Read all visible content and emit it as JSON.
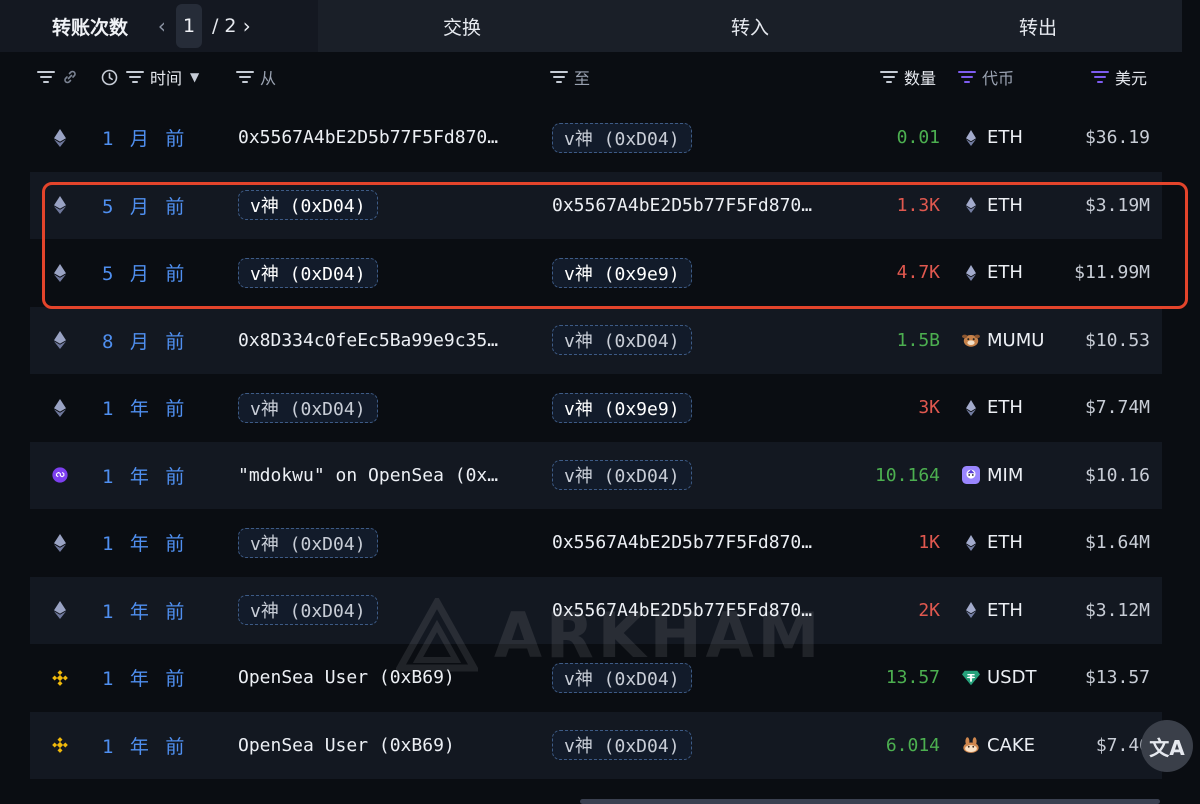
{
  "tabs": {
    "active": "转账次数",
    "pager": {
      "current": "1",
      "sep": "/",
      "total": "2"
    },
    "swap": "交换",
    "in": "转入",
    "out": "转出"
  },
  "columns": {
    "time": "时间",
    "from": "从",
    "to": "至",
    "qty": "数量",
    "token": "代币",
    "usd": "美元"
  },
  "colors": {
    "accent": "#4f8ff0",
    "in": "#4caf50",
    "out": "#e0584f",
    "highlight": "#e3442b",
    "token_filter": "#7e5cf0"
  },
  "rows": [
    {
      "chain": "ethereum-icon",
      "time": "1 月 前",
      "from": "0x5567A4bE2D5b77F5Fd870…",
      "from_pill": false,
      "to": "v神 (0xD04)",
      "to_pill": true,
      "qty": "0.01",
      "dir": "in",
      "token_icon": "eth-icon",
      "token": "ETH",
      "usd": "$36.19"
    },
    {
      "chain": "ethereum-icon",
      "time": "5 月 前",
      "from": "v神 (0xD04)",
      "from_pill": true,
      "to": "0x5567A4bE2D5b77F5Fd870…",
      "to_pill": false,
      "qty": "1.3K",
      "dir": "out",
      "token_icon": "eth-icon",
      "token": "ETH",
      "usd": "$3.19M"
    },
    {
      "chain": "ethereum-icon",
      "time": "5 月 前",
      "from": "v神 (0xD04)",
      "from_pill": true,
      "to": "v神 (0x9e9)",
      "to_pill": true,
      "qty": "4.7K",
      "dir": "out",
      "token_icon": "eth-icon",
      "token": "ETH",
      "usd": "$11.99M"
    },
    {
      "chain": "ethereum-icon",
      "time": "8 月 前",
      "from": "0x8D334c0feEc5Ba99e9c35…",
      "from_pill": false,
      "to": "v神 (0xD04)",
      "to_pill": true,
      "qty": "1.5B",
      "dir": "in",
      "token_icon": "mumu-icon",
      "token": "MUMU",
      "usd": "$10.53"
    },
    {
      "chain": "ethereum-icon",
      "time": "1 年 前",
      "from": "v神 (0xD04)",
      "from_pill": true,
      "to": "v神 (0x9e9)",
      "to_pill": true,
      "qty": "3K",
      "dir": "out",
      "token_icon": "eth-icon",
      "token": "ETH",
      "usd": "$7.74M"
    },
    {
      "chain": "polygon-icon",
      "time": "1 年 前",
      "from": "\"mdokwu\" on OpenSea (0x…",
      "from_pill": false,
      "to": "v神 (0xD04)",
      "to_pill": true,
      "qty": "10.164",
      "dir": "in",
      "token_icon": "mim-icon",
      "token": "MIM",
      "usd": "$10.16"
    },
    {
      "chain": "ethereum-icon",
      "time": "1 年 前",
      "from": "v神 (0xD04)",
      "from_pill": true,
      "to": "0x5567A4bE2D5b77F5Fd870…",
      "to_pill": false,
      "qty": "1K",
      "dir": "out",
      "token_icon": "eth-icon",
      "token": "ETH",
      "usd": "$1.64M"
    },
    {
      "chain": "ethereum-icon",
      "time": "1 年 前",
      "from": "v神 (0xD04)",
      "from_pill": true,
      "to": "0x5567A4bE2D5b77F5Fd870…",
      "to_pill": false,
      "qty": "2K",
      "dir": "out",
      "token_icon": "eth-icon",
      "token": "ETH",
      "usd": "$3.12M"
    },
    {
      "chain": "bnb-chain-icon",
      "time": "1 年 前",
      "from": "OpenSea User (0xB69)",
      "from_pill": false,
      "to": "v神 (0xD04)",
      "to_pill": true,
      "qty": "13.57",
      "dir": "in",
      "token_icon": "usdt-icon",
      "token": "USDT",
      "usd": "$13.57"
    },
    {
      "chain": "bnb-chain-icon",
      "time": "1 年 前",
      "from": "OpenSea User (0xB69)",
      "from_pill": false,
      "to": "v神 (0xD04)",
      "to_pill": true,
      "qty": "6.014",
      "dir": "in",
      "token_icon": "cake-icon",
      "token": "CAKE",
      "usd": "$7.40"
    }
  ],
  "watermark": "ARKHAM",
  "translate_label": "文A"
}
